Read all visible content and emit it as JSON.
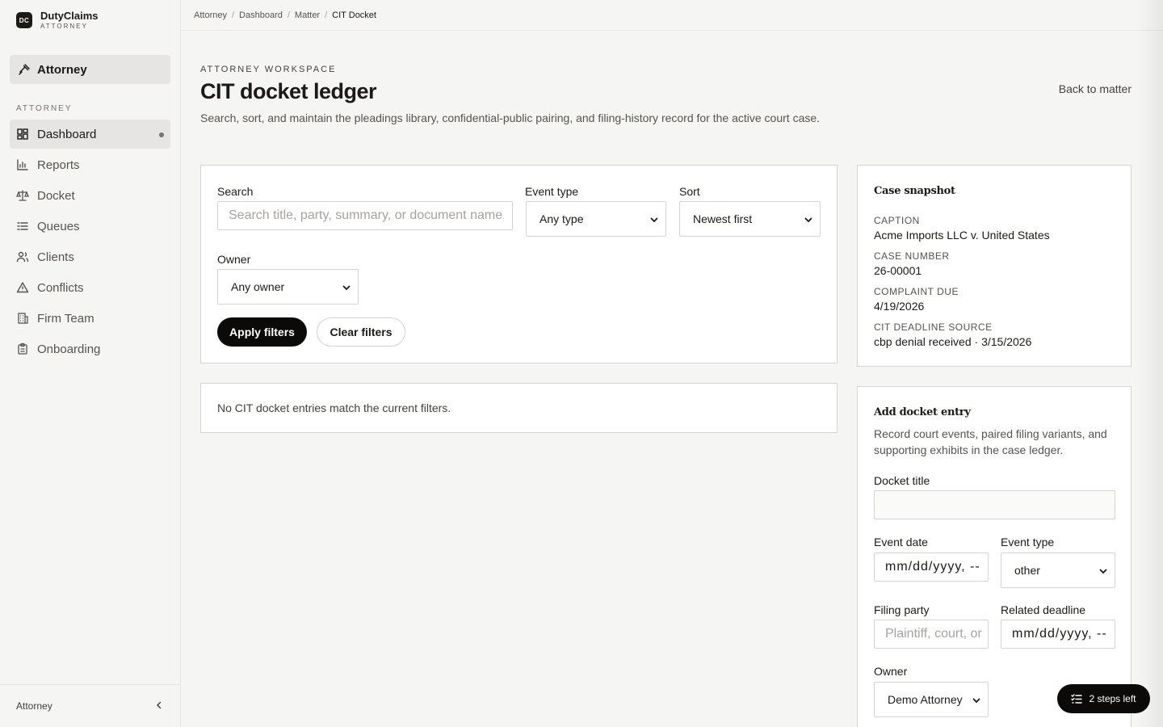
{
  "brand": {
    "logo_text": "DC",
    "name": "DutyClaims",
    "subtitle": "ATTORNEY"
  },
  "role_switcher": {
    "label": "Attorney",
    "icon": "gavel-icon"
  },
  "sidebar": {
    "section_label": "ATTORNEY",
    "items": [
      {
        "label": "Dashboard",
        "icon": "dashboard-icon",
        "active": true
      },
      {
        "label": "Reports",
        "icon": "bar-chart-icon"
      },
      {
        "label": "Docket",
        "icon": "scale-icon"
      },
      {
        "label": "Queues",
        "icon": "list-icon"
      },
      {
        "label": "Clients",
        "icon": "users-icon"
      },
      {
        "label": "Conflicts",
        "icon": "warning-icon"
      },
      {
        "label": "Firm Team",
        "icon": "building-icon"
      },
      {
        "label": "Onboarding",
        "icon": "clipboard-icon"
      }
    ],
    "footer_label": "Attorney"
  },
  "breadcrumb": [
    "Attorney",
    "Dashboard",
    "Matter",
    "CIT Docket"
  ],
  "header": {
    "eyebrow": "ATTORNEY WORKSPACE",
    "title": "CIT docket ledger",
    "description": "Search, sort, and maintain the pleadings library, confidential-public pairing, and filing-history record for the active court case.",
    "back_link": "Back to matter"
  },
  "filters": {
    "search_label": "Search",
    "search_placeholder": "Search title, party, summary, or document name",
    "event_type_label": "Event type",
    "event_type_value": "Any type",
    "sort_label": "Sort",
    "sort_value": "Newest first",
    "owner_label": "Owner",
    "owner_value": "Any owner",
    "apply_label": "Apply filters",
    "clear_label": "Clear filters"
  },
  "empty_state": "No CIT docket entries match the current filters.",
  "snapshot": {
    "heading": "Case snapshot",
    "caption_key": "CAPTION",
    "caption_val": "Acme Imports LLC v. United States",
    "case_number_key": "CASE NUMBER",
    "case_number_val": "26-00001",
    "complaint_due_key": "COMPLAINT DUE",
    "complaint_due_val": "4/19/2026",
    "deadline_source_key": "CIT DEADLINE SOURCE",
    "deadline_source_val": "cbp denial received · 3/15/2026"
  },
  "add_entry": {
    "heading": "Add docket entry",
    "description": "Record court events, paired filing variants, and supporting exhibits in the case ledger.",
    "docket_title_label": "Docket title",
    "docket_title_value": "",
    "event_date_label": "Event date",
    "event_date_placeholder": "mm/dd/yyyy, --",
    "event_type_label": "Event type",
    "event_type_value": "other",
    "filing_party_label": "Filing party",
    "filing_party_placeholder": "Plaintiff, court, or",
    "related_deadline_label": "Related deadline",
    "related_deadline_placeholder": "mm/dd/yyyy, --",
    "owner_label": "Owner",
    "owner_value": "Demo Attorney"
  },
  "steps_pill": {
    "label": "2 steps left",
    "icon": "checklist-icon"
  }
}
